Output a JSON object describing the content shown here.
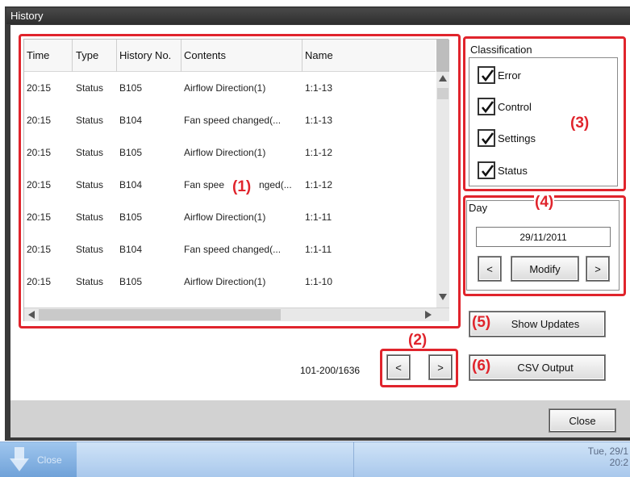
{
  "window": {
    "title": "History"
  },
  "table": {
    "columns": [
      "Time",
      "Type",
      "History No.",
      "Contents",
      "Name"
    ],
    "rows": [
      [
        "20:15",
        "Status",
        "B105",
        "Airflow Direction(1)",
        "1:1-13"
      ],
      [
        "20:15",
        "Status",
        "B104",
        "Fan speed changed(...",
        "1:1-13"
      ],
      [
        "20:15",
        "Status",
        "B105",
        "Airflow Direction(1)",
        "1:1-12"
      ],
      [
        "20:15",
        "Status",
        "B104",
        "Fan spee",
        "1:1-12"
      ],
      [
        "20:15",
        "Status",
        "B105",
        "Airflow Direction(1)",
        "1:1-11"
      ],
      [
        "20:15",
        "Status",
        "B104",
        "Fan speed changed(...",
        "1:1-11"
      ],
      [
        "20:15",
        "Status",
        "B105",
        "Airflow Direction(1)",
        "1:1-10"
      ]
    ],
    "row4_contents_tail": "nged(..."
  },
  "classification": {
    "title": "Classification",
    "items": [
      {
        "label": "Error",
        "checked": true
      },
      {
        "label": "Control",
        "checked": true
      },
      {
        "label": "Settings",
        "checked": true
      },
      {
        "label": "Status",
        "checked": true
      }
    ]
  },
  "day": {
    "title": "Day",
    "date": "29/11/2011",
    "prev_label": "<",
    "modify_label": "Modify",
    "next_label": ">"
  },
  "buttons": {
    "show_updates": "Show Updates",
    "csv_output": "CSV Output",
    "close": "Close"
  },
  "pagination": {
    "info": "101-200/1636",
    "prev_label": "<",
    "next_label": ">"
  },
  "markers": {
    "m1": "(1)",
    "m2": "(2)",
    "m3": "(3)",
    "m4": "(4)",
    "m5": "(5)",
    "m6": "(6)"
  },
  "taskbar": {
    "close_label": "Close",
    "clock_line1": "Tue, 29/1",
    "clock_line2": "20:2"
  },
  "colors": {
    "annotation_red": "#e0242c",
    "taskbar_blue": "#a9c8ec"
  }
}
